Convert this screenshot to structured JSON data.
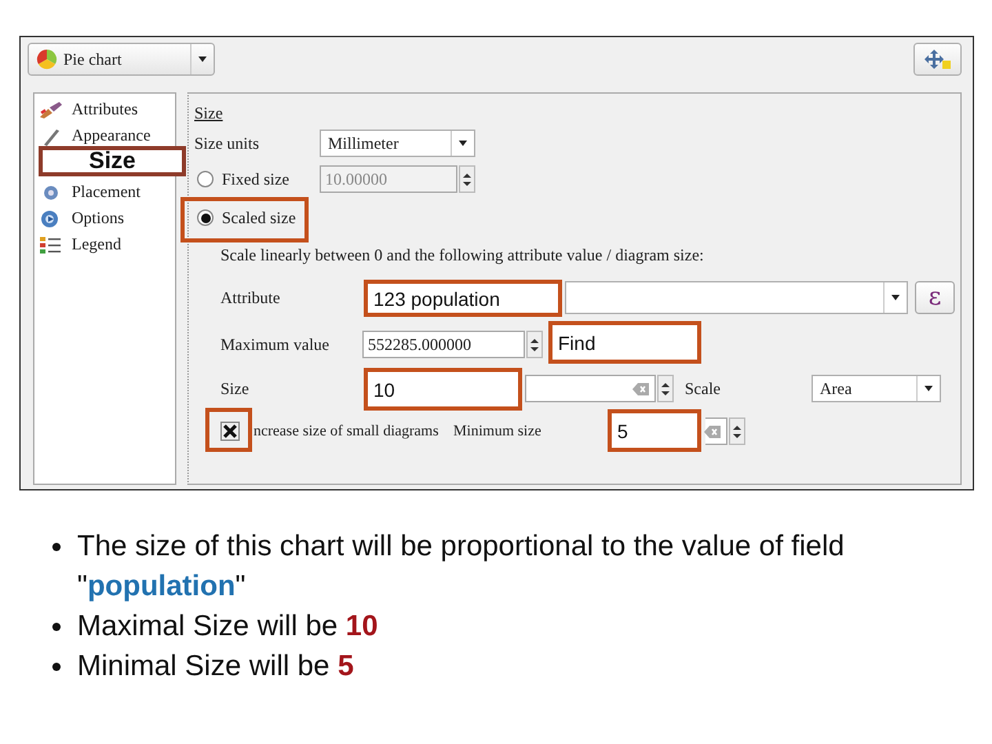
{
  "dialog": {
    "diagram_type": {
      "label": "Pie chart"
    },
    "sidebar": {
      "items": [
        {
          "label": "Attributes",
          "kind": "brush"
        },
        {
          "label": "Appearance",
          "kind": "pen"
        },
        {
          "label": "Placement",
          "kind": "placement"
        },
        {
          "label": "Options",
          "kind": "options"
        },
        {
          "label": "Legend",
          "kind": "legend"
        }
      ]
    },
    "size_group": {
      "title": "Size",
      "size_units": {
        "label": "Size units",
        "value": "Millimeter"
      },
      "modes": [
        {
          "label": "Fixed size",
          "selected": false,
          "value": "10.00000",
          "disabled": true
        },
        {
          "label": "Scaled size",
          "selected": true
        }
      ],
      "scale_note": "Scale linearly between 0 and the following attribute value / diagram size:",
      "attribute": {
        "label": "Attribute",
        "expression_button": "ε"
      },
      "maximum_value": {
        "label": "Maximum value",
        "value": "552285.000000"
      },
      "size": {
        "label": "Size"
      },
      "scale": {
        "label": "Scale",
        "value": "Area"
      },
      "increase_small": {
        "label": "ncrease size of small diagrams",
        "checked": true
      },
      "minimum_size": {
        "label": "Minimum size"
      }
    }
  },
  "callouts": [
    {
      "kind": "label",
      "text": "Size"
    },
    {
      "kind": "frame"
    },
    {
      "kind": "label",
      "text": "123 population"
    },
    {
      "kind": "label",
      "text": "Find"
    },
    {
      "kind": "label",
      "text": "10"
    },
    {
      "kind": "frame"
    },
    {
      "kind": "label",
      "text": "5"
    }
  ],
  "bullets": [
    {
      "text": "The size of this chart will be proportional to the value of field \"**population**\""
    },
    {
      "text": "Maximal Size will be **10**"
    },
    {
      "text": "Minimal Size will be **5**"
    }
  ]
}
